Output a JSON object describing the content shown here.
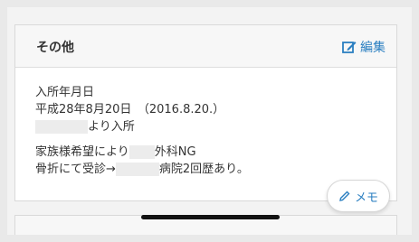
{
  "section": {
    "title": "その他",
    "edit_label": "編集"
  },
  "body": {
    "admission_label": "入所年月日",
    "admission_date": "平成28年8月20日　（2016.8.20.）",
    "admission_source_suffix": "より入所",
    "note_line1_prefix": "家族様希望により",
    "note_line1_suffix": "外科NG",
    "note_line2_prefix": "骨折にて受診→",
    "note_line2_suffix": "病院2回歴あり。"
  },
  "memo_button": {
    "label": "メモ"
  },
  "colors": {
    "accent": "#2b7fc1",
    "header_bg": "#f7f7f7",
    "page_bg": "#e9e9e9"
  },
  "icons": {
    "edit": "pencil-square-icon",
    "memo": "pencil-icon"
  }
}
